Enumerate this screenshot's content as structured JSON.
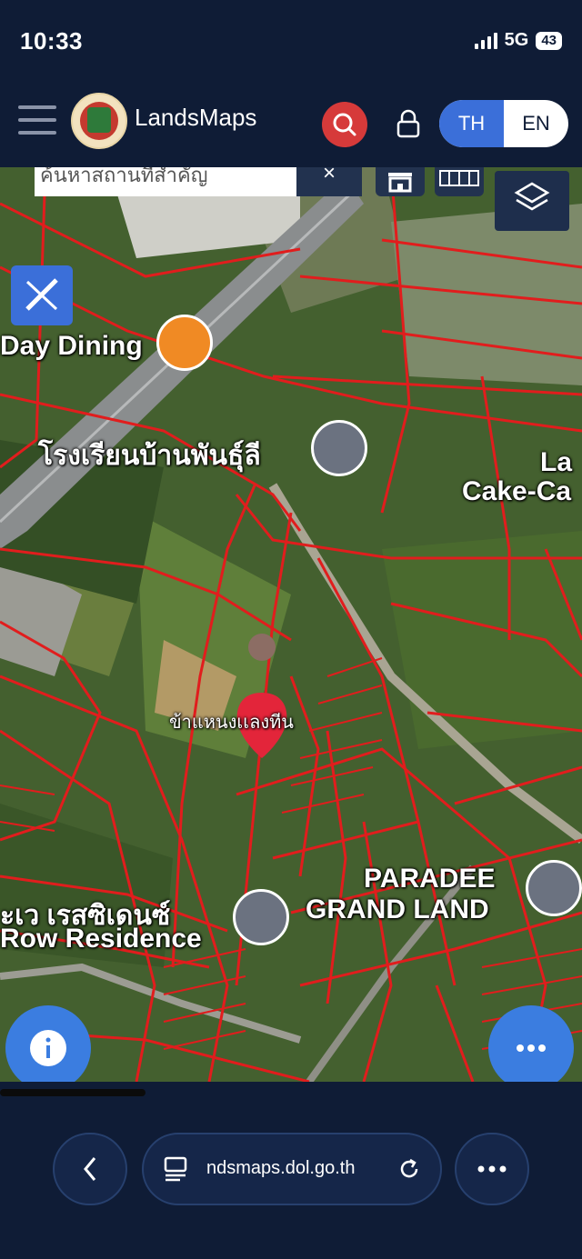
{
  "status_bar": {
    "time": "10:33",
    "network": "5G",
    "battery": "43"
  },
  "app_bar": {
    "brand": "LandsMaps",
    "lang_th": "TH",
    "lang_en": "EN"
  },
  "map": {
    "search_placeholder": "ค้นหาสถานที่สำคัญ",
    "clear_symbol": "×",
    "labels": {
      "day_dining": "Day Dining",
      "school": "โรงเรียนบ้านพันธุ์ลี",
      "cake_1": "La",
      "cake_2": "Cake-Ca",
      "marker_label": "ข้าแหนงเเลงทีน",
      "paradee_1": "PARADEE",
      "paradee_2": "GRAND LAND",
      "residence_1": "ะเว เรสซิเดนซ์",
      "residence_2": "Row Residence"
    },
    "icons": [
      "search-icon",
      "lock-icon",
      "layers-icon",
      "ruler-pencil-icon",
      "restaurant-icon",
      "school-icon",
      "location-pin-icon",
      "info-icon",
      "more-icon"
    ]
  },
  "browser": {
    "url": "ndsmaps.dol.go.th"
  },
  "colors": {
    "navy": "#0f1c36",
    "accent_blue": "#3b6fd9",
    "red": "#d63a3a",
    "parcel_lines": "#e11d1d"
  }
}
